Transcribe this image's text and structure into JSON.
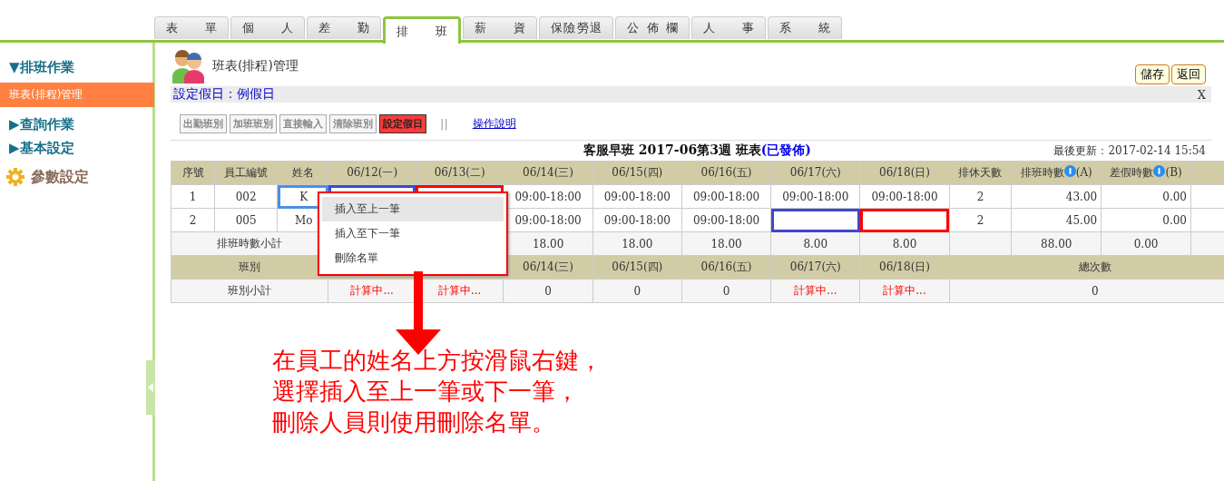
{
  "tabs": [
    {
      "label": "表單",
      "selected": false
    },
    {
      "label": "個人",
      "selected": false
    },
    {
      "label": "差勤",
      "selected": false
    },
    {
      "label": "排班",
      "selected": true
    },
    {
      "label": "薪資",
      "selected": false
    },
    {
      "label": "保險勞退",
      "selected": false
    },
    {
      "label": "公佈欄",
      "selected": false
    },
    {
      "label": "人事",
      "selected": false
    },
    {
      "label": "系統",
      "selected": false
    }
  ],
  "sidebar": {
    "items": [
      {
        "kind": "section",
        "label": "▼排班作業",
        "selected": false
      },
      {
        "kind": "item",
        "label": "班表(排程)管理",
        "selected": true
      },
      {
        "kind": "section",
        "label": "▶查詢作業",
        "selected": false
      },
      {
        "kind": "section",
        "label": "▶基本設定",
        "selected": false
      },
      {
        "kind": "gear",
        "label": "參數設定",
        "selected": false
      }
    ]
  },
  "page": {
    "title": "班表(排程)管理",
    "actions": [
      "儲存",
      "返回"
    ],
    "notice": "設定假日：例假日",
    "close": "X"
  },
  "toolbar": {
    "buttons": [
      {
        "label": "出勤班別",
        "kind": "plain"
      },
      {
        "label": "加班班別",
        "kind": "plain"
      },
      {
        "label": "直接輸入",
        "kind": "plain"
      },
      {
        "label": "清除班別",
        "kind": "plain"
      },
      {
        "label": "設定假日",
        "kind": "active"
      }
    ],
    "separator": "||",
    "help": "操作說明"
  },
  "schedule": {
    "title": "客服早班 2017-06第3週 班表",
    "status": "(已發佈)",
    "updated": "最後更新：2017-02-14 15:54",
    "columns": [
      {
        "text": "序號"
      },
      {
        "text": "員工編號"
      },
      {
        "text": "姓名"
      },
      {
        "text": "06/12(一)"
      },
      {
        "text": "06/13(二)"
      },
      {
        "text": "06/14(三)"
      },
      {
        "text": "06/15(四)"
      },
      {
        "text": "06/16(五)"
      },
      {
        "text": "06/17(六)"
      },
      {
        "text": "06/18(日)"
      },
      {
        "text": "排休天數"
      },
      {
        "text": "排班時數",
        "info": true,
        "suffix": "(A)"
      },
      {
        "text": "差假時數",
        "info": true,
        "suffix": "(B)"
      },
      {}
    ],
    "rows": [
      [
        {
          "text": "1"
        },
        {
          "text": "002"
        },
        {
          "text": "K",
          "color": "#4a90e2"
        },
        {
          "color": "#3f48cc"
        },
        {
          "color": "#ff0000"
        },
        {
          "text": "09:00-18:00"
        },
        {
          "text": "09:00-18:00"
        },
        {
          "text": "09:00-18:00"
        },
        {
          "text": "09:00-18:00"
        },
        {
          "text": "09:00-18:00"
        },
        {
          "text": "2"
        },
        {
          "text": "43.00"
        },
        {
          "text": "0.00"
        },
        {}
      ],
      [
        {
          "text": "2"
        },
        {
          "text": "005"
        },
        {
          "text": "Mo"
        },
        {},
        {},
        {
          "text": "09:00-18:00"
        },
        {
          "text": "09:00-18:00"
        },
        {
          "text": "09:00-18:00"
        },
        {
          "color": "#3f48cc"
        },
        {
          "color": "#ff0000"
        },
        {
          "text": "2"
        },
        {
          "text": "45.00"
        },
        {
          "text": "0.00"
        },
        {}
      ]
    ],
    "subtotal": {
      "label": "排班時數小計",
      "cells": [
        {},
        {},
        {
          "text": "18.00"
        },
        {
          "text": "18.00"
        },
        {
          "text": "18.00"
        },
        {
          "text": "8.00"
        },
        {
          "text": "8.00"
        },
        {},
        {
          "text": "88.00"
        },
        {
          "text": "0.00"
        },
        {}
      ]
    },
    "shift_header": {
      "label": "班別",
      "cells": [
        {},
        {},
        {
          "text": "06/14(三)"
        },
        {
          "text": "06/15(四)"
        },
        {
          "text": "06/16(五)"
        },
        {
          "text": "06/17(六)"
        },
        {
          "text": "06/18(日)"
        }
      ],
      "total": "總次數"
    },
    "shift_subtotal": {
      "label": "班別小計",
      "cells": [
        {
          "text": "計算中...",
          "kind": "pending"
        },
        {
          "text": "計算中...",
          "kind": "pending"
        },
        {
          "text": "0",
          "kind": "count"
        },
        {
          "text": "0",
          "kind": "count"
        },
        {
          "text": "0",
          "kind": "count"
        },
        {
          "text": "計算中...",
          "kind": "pending"
        },
        {
          "text": "計算中...",
          "kind": "pending"
        }
      ],
      "total": "0"
    }
  },
  "context_menu": {
    "items": [
      {
        "label": "插入至上一筆",
        "selected": true
      },
      {
        "label": "插入至下一筆",
        "selected": false
      },
      {
        "label": "刪除名單",
        "selected": false
      }
    ]
  },
  "annotation": {
    "lines": [
      "在員工的姓名上方按滑鼠右鍵，",
      "選擇插入至上一筆或下一筆，",
      "刪除人員則使用刪除名單。"
    ]
  }
}
